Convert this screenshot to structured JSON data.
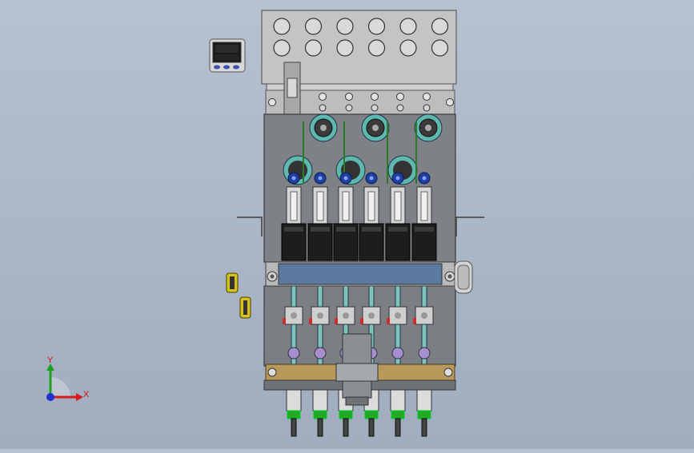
{
  "viewport": {
    "background_color": "#aab6c6"
  },
  "triad": {
    "x_label": "X",
    "y_label": "Y",
    "x_color": "#d81c1c",
    "y_color": "#1fa01f",
    "z_color": "#1f2fd0"
  },
  "assembly": {
    "nozzle_stations": 6,
    "pulley_color": "#5fb8b0",
    "motor_color": "#1d1d1d",
    "knob_color": "#1e3ea8",
    "coupling_green": "#2e8a2e",
    "brass_color": "#b8995a"
  }
}
